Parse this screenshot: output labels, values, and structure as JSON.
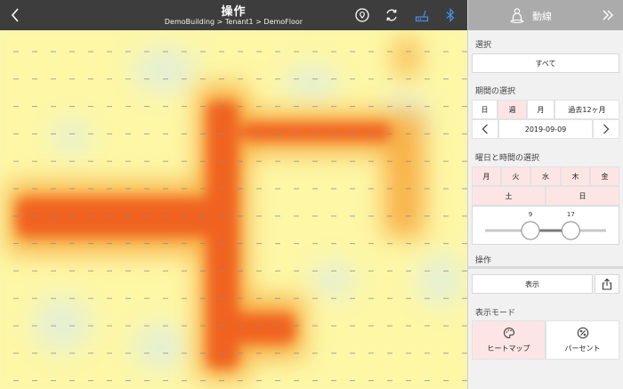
{
  "header": {
    "title": "操作",
    "breadcrumb": "DemoBuilding > Tenant1 > DemoFloor"
  },
  "panel": {
    "title": "動線",
    "selection": {
      "label": "選択",
      "value": "すべて"
    },
    "period": {
      "label": "期間の選択",
      "options": [
        "日",
        "週",
        "月",
        "過去12ヶ月"
      ],
      "selected": "週",
      "date": "2019-09-09"
    },
    "weekday_time": {
      "label": "曜日と時間の選択",
      "weekdays": [
        "月",
        "火",
        "水",
        "木",
        "金"
      ],
      "weekend": [
        "土",
        "日"
      ],
      "slider_start": "9",
      "slider_end": "17",
      "slider_min_hour": 0,
      "slider_max_hour": 24
    },
    "operation": {
      "label": "操作",
      "display_button": "表示"
    },
    "display_mode": {
      "label": "表示モード",
      "heatmap": "ヒートマップ",
      "percent": "パーセント",
      "selected": "ヒートマップ"
    }
  },
  "colors": {
    "topbar": "#3d3d3d",
    "panel_bg": "#f1f1f1",
    "accent_pink": "#fde5e5",
    "bluetooth_icon": "#4a90e2",
    "heat_low": "#fdf7a6",
    "heat_high": "#ef5a1c"
  },
  "icons": {
    "back": "chevron-left-icon",
    "location": "location-pin-icon",
    "refresh": "refresh-icon",
    "router": "router-icon",
    "bluetooth": "bluetooth-icon",
    "person": "person-icon",
    "collapse": "double-chevron-right-icon",
    "share": "share-icon",
    "palette": "palette-icon",
    "percent": "percent-icon"
  }
}
